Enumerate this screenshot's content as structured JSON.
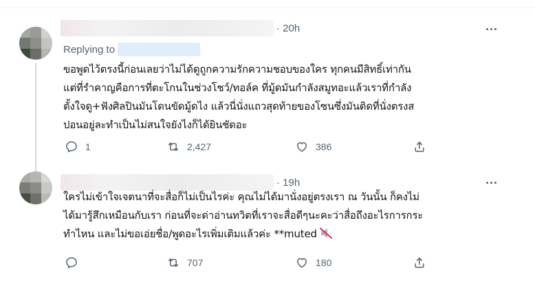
{
  "tweets": [
    {
      "time": "· 20h",
      "replying_to_label": "Replying to",
      "lines": [
        "ขอพูดไว้ตรงนี้ก่อนเลยว่าไม่ได้ดูถูกความรักความชอบของใคร ทุกคนมีสิทธิ์เท่ากัน",
        "แต่ที่รำคาญคือการที่ตะโกนในช่วงโชว์/ทอล์ค ที่มู้ดมันกำลังสมูทอะแล้วเราที่กำลัง",
        "ตั้งใจดู+ฟังศิลปินมันโดนขัดมู้ดไง แล้วนี่นั่งแถวสุดท้ายของโซนซึ่งมันติดที่นั่งตรงส",
        "ปอนอยู่ละทำเป็นไม่สนใจยังไงก็ได้ยินชัดอะ"
      ],
      "actions": {
        "replies": "1",
        "retweets": "2,427",
        "likes": "386"
      }
    },
    {
      "time": "· 19h",
      "lines": [
        "ใครไม่เข้าใจเจตนาที่จะสื่อก็ไม่เป็นไรค่ะ คุณไม่ได้มานั่งอยู่ตรงเรา ณ วันนั้น ก็คงไม่",
        "ได้มารู้สึกเหมือนกับเรา ก่อนที่จะด่าอ่านทวิตที่เราจะสื่อดีๆนะคะว่าสื่อถึงอะไรการกระ",
        "ทำไหน และไม่ขอเอ่ยชื่อ/พูดอะไรเพิ่มเติมแล้วค่ะ **muted"
      ],
      "actions": {
        "replies": "",
        "retweets": "707",
        "likes": "180"
      }
    }
  ],
  "icons": {
    "reply": "reply-icon",
    "retweet": "retweet-icon",
    "like": "like-icon",
    "share": "share-icon",
    "more": "more-icon",
    "muted": "muted-speaker-icon"
  },
  "colors": {
    "secondary_text": "#536471",
    "primary_text": "#0f1419",
    "mention_blue": "#1d9bf0"
  }
}
